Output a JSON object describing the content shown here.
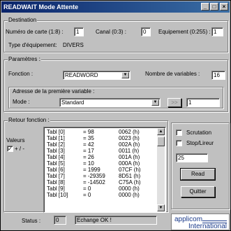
{
  "window": {
    "title": "READWAIT   Mode Attente",
    "minimize": "_",
    "maximize": "□",
    "close": "×"
  },
  "destination": {
    "legend": "Destination",
    "card_label": "Numéro de carte (1:8) :",
    "card_value": "1",
    "canal_label": "Canal (0:3) :",
    "canal_value": "0",
    "equipment_label": "Equipement (0:255) :",
    "equipment_value": "1",
    "type_label": "Type d'équipement:",
    "type_value": "DIVERS"
  },
  "parametres": {
    "legend": "Paramètres :",
    "fonction_label": "Fonction :",
    "fonction_value": "READWORD",
    "nb_label": "Nombre de variables :",
    "nb_value": "16",
    "adresse_label": "Adresse de la première variable :",
    "mode_label": "Mode :",
    "mode_value": "Standard",
    "arrow_button": ">>",
    "address_value": "1"
  },
  "retour": {
    "legend": "Retour fonction :",
    "valeurs_label": "Valeurs",
    "plus_minus_label": "+ / -",
    "plus_minus_checked": true,
    "rows": [
      {
        "name": "Tabl [0]",
        "dec": "= 98",
        "hex": "0062  (h)"
      },
      {
        "name": "Tabl [1]",
        "dec": "= 35",
        "hex": "0023  (h)"
      },
      {
        "name": "Tabl [2]",
        "dec": "= 42",
        "hex": "002A  (h)"
      },
      {
        "name": "Tabl [3]",
        "dec": "= 17",
        "hex": "0011  (h)"
      },
      {
        "name": "Tabl [4]",
        "dec": "= 26",
        "hex": "001A  (h)"
      },
      {
        "name": "Tabl [5]",
        "dec": "= 10",
        "hex": "000A  (h)"
      },
      {
        "name": "Tabl [6]",
        "dec": "= 1999",
        "hex": "07CF  (h)"
      },
      {
        "name": "Tabl [7]",
        "dec": "= -29359",
        "hex": "8D51  (h)"
      },
      {
        "name": "Tabl [8]",
        "dec": "= -14502",
        "hex": "C75A  (h)"
      },
      {
        "name": "Tabl [9]",
        "dec": "= 0",
        "hex": "0000  (h)"
      },
      {
        "name": "Tabl [10]",
        "dec": "= 0",
        "hex": "0000  (h)"
      }
    ],
    "status_label": "Status :",
    "status_value": "0",
    "message_value": "Echange OK !"
  },
  "side": {
    "scrutation_label": "Scrutation",
    "stop_label": "Stop/Lireur",
    "interval_value": "25",
    "read_button": "Read",
    "quit_button": "Quitter"
  },
  "logo": {
    "line1": "applicom",
    "line2": "International"
  }
}
